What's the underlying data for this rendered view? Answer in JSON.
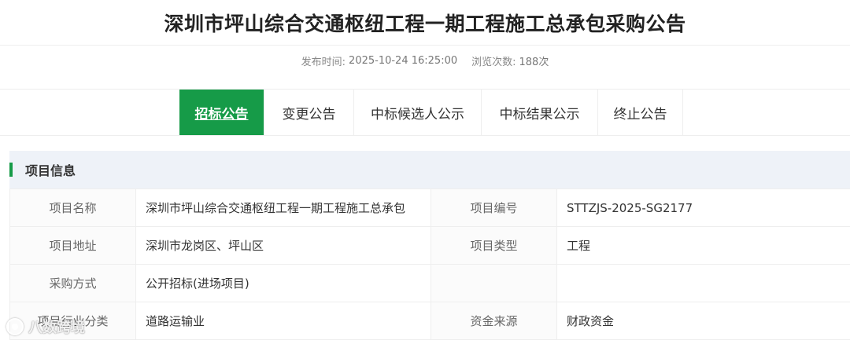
{
  "page": {
    "title": "深圳市坪山综合交通枢纽工程一期工程施工总承包采购公告"
  },
  "meta": {
    "publish_label": "发布时间:",
    "publish_time": "2025-10-24 16:25:00",
    "views_label": "浏览次数:",
    "views_count": "188次"
  },
  "tabs": [
    {
      "label": "招标公告",
      "active": true
    },
    {
      "label": "变更公告",
      "active": false
    },
    {
      "label": "中标候选人公示",
      "active": false
    },
    {
      "label": "中标结果公示",
      "active": false
    },
    {
      "label": "终止公告",
      "active": false
    }
  ],
  "section": {
    "title": "项目信息"
  },
  "info": {
    "rows": [
      {
        "l1": "项目名称",
        "v1": "深圳市坪山综合交通枢纽工程一期工程施工总承包",
        "l2": "项目编号",
        "v2": "STTZJS-2025-SG2177"
      },
      {
        "l1": "项目地址",
        "v1": "深圳市龙岗区、坪山区",
        "l2": "项目类型",
        "v2": "工程"
      },
      {
        "l1": "采购方式",
        "v1": "公开招标(进场项目)",
        "l2": "",
        "v2": ""
      },
      {
        "l1": "项目行业分类",
        "v1": "道路运输业",
        "l2": "资金来源",
        "v2": "财政资金"
      }
    ]
  },
  "watermark": {
    "text": "八数跨境"
  },
  "colors": {
    "accent": "#169b48",
    "section_bg": "#eef2f8",
    "border": "#eeeeee"
  }
}
